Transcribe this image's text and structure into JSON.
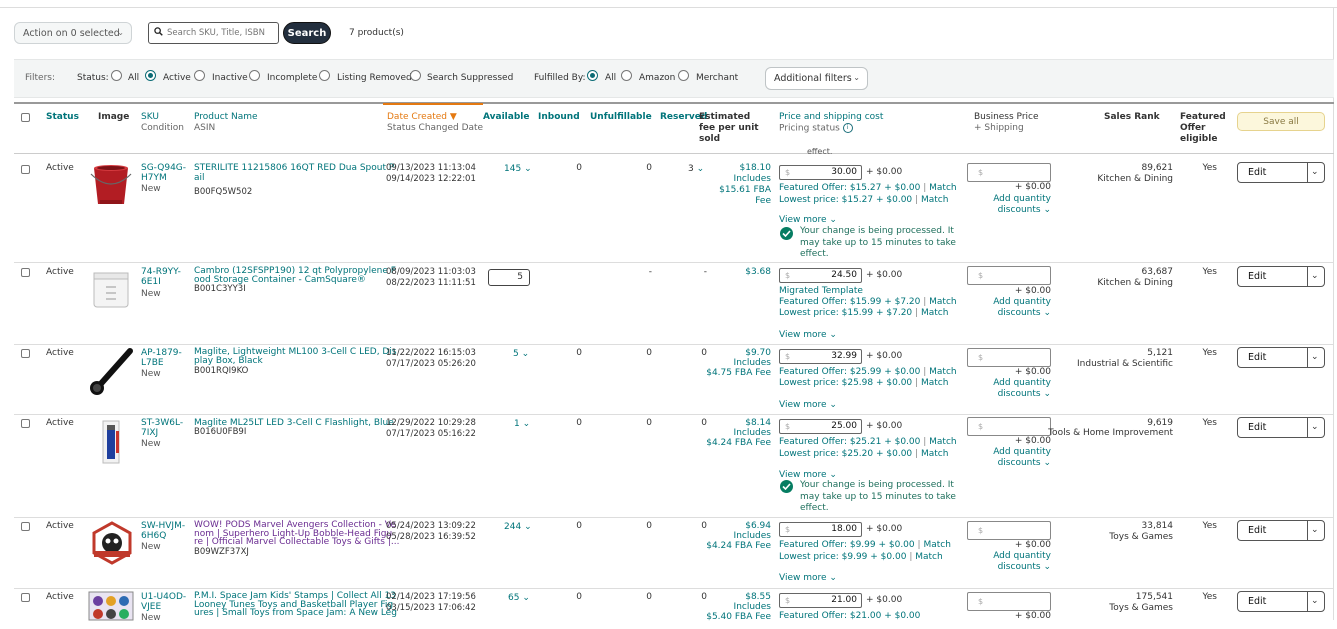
{
  "toolbar": {
    "action_label": "Action on 0 selected",
    "search_placeholder": "Search SKU, Title, ISBN",
    "search_button": "Search",
    "products_count": "7 product(s)"
  },
  "filters": {
    "label": "Filters:",
    "status_label": "Status:",
    "status_options": [
      "All",
      "Active",
      "Inactive",
      "Incomplete",
      "Listing Removed",
      "Search Suppressed"
    ],
    "status_selected": "Active",
    "fulfilled_label": "Fulfilled By:",
    "fulfilled_options": [
      "All",
      "Amazon",
      "Merchant"
    ],
    "fulfilled_selected": "All",
    "additional": "Additional filters"
  },
  "header": {
    "status": "Status",
    "image": "Image",
    "sku": "SKU",
    "condition": "Condition",
    "product_name": "Product Name",
    "asin": "ASIN",
    "date_created": "Date Created",
    "status_changed": "Status Changed Date",
    "available": "Available",
    "inbound": "Inbound",
    "unfulfillable": "Unfulfillable",
    "reserved": "Reserved",
    "est_fee_1": "Estimated",
    "est_fee_2": "fee per unit",
    "est_fee_3": "sold",
    "price_shipping": "Price and shipping cost",
    "pricing_status": "Pricing status",
    "business_price": "Business Price",
    "plus_shipping": "+ Shipping",
    "sales_rank": "Sales Rank",
    "featured_1": "Featured",
    "featured_2": "Offer",
    "featured_3": "eligible",
    "save_all": "Save all"
  },
  "common": {
    "currency": "$",
    "plus_zero": "+ $0.00",
    "add_qty_1": "Add quantity",
    "add_qty_2": "discounts",
    "view_more": "View more",
    "match": "Match",
    "edit": "Edit",
    "includes": "Includes",
    "processing_1": "Your change is being processed. It",
    "processing_2": "may take up to 15 minutes to take",
    "processing_3": "effect.",
    "partial_effect": "effect."
  },
  "rows": [
    {
      "status": "Active",
      "sku_1": "SG-Q94G-",
      "sku_2": "H7YM",
      "condition": "New",
      "name_1": "STERILITE 11215806 16QT RED Dua Spout P",
      "name_2": "ail",
      "asin": "B00FQ5W502",
      "date_created": "09/13/2023 11:13:04",
      "date_changed": "09/14/2023 12:22:01",
      "available": "145",
      "inbound": "0",
      "unfulfillable": "0",
      "reserved": "3",
      "fee": "$18.10",
      "fee_2": "$15.61 FBA",
      "fee_3": "Fee",
      "price": "30.00",
      "ship": "+ $0.00",
      "featured_offer": "Featured Offer: $15.27 + $0.00",
      "lowest_price": "Lowest price: $15.27 + $0.00",
      "rank": "89,621",
      "category": "Kitchen & Dining",
      "featured": "Yes"
    },
    {
      "status": "Active",
      "sku_1": "74-R9YY-",
      "sku_2": "6E1I",
      "condition": "New",
      "name_1": "Cambro (12SFSPP190) 12 qt Polypropylene F",
      "name_2": "ood Storage Container - CamSquare®",
      "asin": "B001C3YY3I",
      "date_created": "08/09/2023 11:03:03",
      "date_changed": "08/22/2023 11:11:51",
      "available": "5",
      "inbound": "-",
      "unfulfillable": "-",
      "fee": "$3.68",
      "price": "24.50",
      "ship": "+ $0.00",
      "template": "Migrated Template",
      "featured_offer": "Featured Offer: $15.99 + $7.20",
      "lowest_price": "Lowest price: $15.99 + $7.20",
      "rank": "63,687",
      "category": "Kitchen & Dining",
      "featured": "Yes"
    },
    {
      "status": "Active",
      "sku_1": "AP-1879-",
      "sku_2": "L7BE",
      "condition": "New",
      "name_1": "Maglite, Lightweight ML100 3-Cell C LED, Dis",
      "name_2": "play Box, Black",
      "asin": "B001RQI9KO",
      "date_created": "11/22/2022 16:15:03",
      "date_changed": "07/17/2023 05:26:20",
      "available": "5",
      "inbound": "0",
      "unfulfillable": "0",
      "reserved": "0",
      "fee": "$9.70",
      "fee_2": "$4.75 FBA Fee",
      "price": "32.99",
      "ship": "+ $0.00",
      "featured_offer": "Featured Offer: $25.99 + $0.00",
      "lowest_price": "Lowest price: $25.98 + $0.00",
      "rank": "5,121",
      "category": "Industrial & Scientific",
      "featured": "Yes"
    },
    {
      "status": "Active",
      "sku_1": "ST-3W6L-",
      "sku_2": "7IXJ",
      "condition": "New",
      "name_1": "Maglite ML25LT LED 3-Cell C Flashlight, Blue",
      "asin": "B016U0FB9I",
      "date_created": "12/29/2022 10:29:28",
      "date_changed": "07/17/2023 05:16:22",
      "available": "1",
      "inbound": "0",
      "unfulfillable": "0",
      "reserved": "0",
      "fee": "$8.14",
      "fee_2": "$4.24 FBA Fee",
      "price": "25.00",
      "ship": "+ $0.00",
      "featured_offer": "Featured Offer: $25.21 + $0.00",
      "lowest_price": "Lowest price: $25.20 + $0.00",
      "rank": "9,619",
      "category": "Tools & Home Improvement",
      "featured": "Yes"
    },
    {
      "status": "Active",
      "sku_1": "SW-HVJM-",
      "sku_2": "6H6Q",
      "condition": "New",
      "name_1": "WOW! PODS Marvel Avengers Collection - Ve",
      "name_2": "nom | Superhero Light-Up Bobble-Head Figu",
      "name_3": "re | Official Marvel Collectable Toys & Gifts |...",
      "asin": "B09WZF37XJ",
      "date_created": "05/24/2023 13:09:22",
      "date_changed": "05/28/2023 16:39:52",
      "available": "244",
      "inbound": "0",
      "unfulfillable": "0",
      "reserved": "0",
      "fee": "$6.94",
      "fee_2": "$4.24 FBA Fee",
      "price": "18.00",
      "ship": "+ $0.00",
      "featured_offer": "Featured Offer: $9.99 + $0.00",
      "lowest_price": "Lowest price: $9.99 + $0.00",
      "rank": "33,814",
      "category": "Toys & Games",
      "featured": "Yes"
    },
    {
      "status": "Active",
      "sku_1": "U1-U4OD-",
      "sku_2": "VJEE",
      "condition": "New",
      "name_1": "P.M.I. Space Jam Kids' Stamps | Collect All 13",
      "name_2": "Looney Tunes Toys and Basketball Player Fig",
      "name_3": "ures | Small Toys from Space Jam: A New Leg",
      "date_created": "02/14/2023 17:19:56",
      "date_changed": "03/15/2023 17:06:42",
      "available": "65",
      "inbound": "0",
      "unfulfillable": "0",
      "reserved": "0",
      "fee": "$8.55",
      "fee_2": "$5.40 FBA Fee",
      "price": "21.00",
      "ship": "+ $0.00",
      "featured_offer": "Featured Offer: $21.00 + $0.00",
      "rank": "175,541",
      "category": "Toys & Games",
      "featured": "Yes"
    }
  ]
}
